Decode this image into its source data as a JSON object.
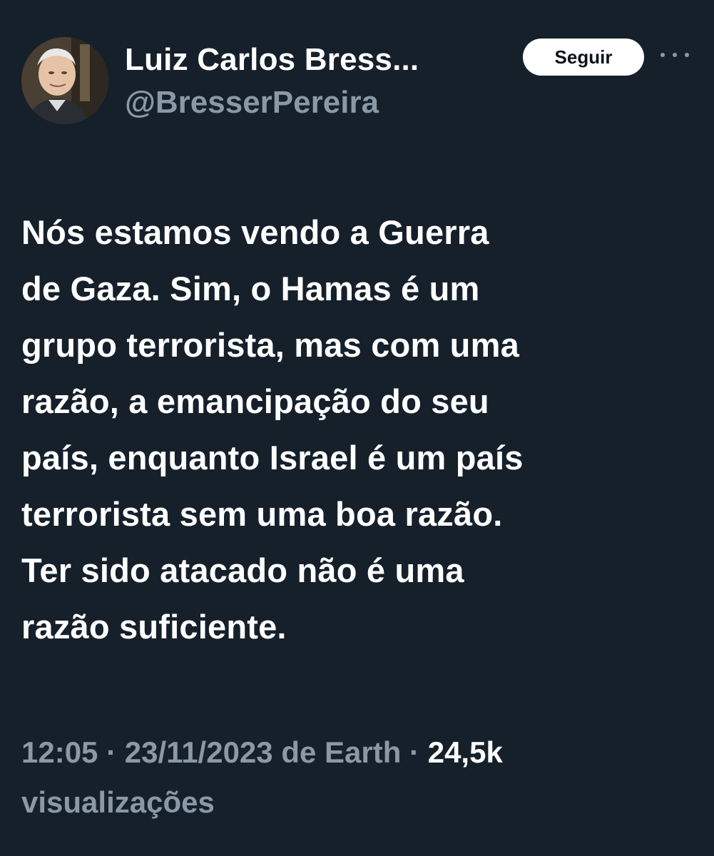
{
  "author": {
    "display_name": "Luiz Carlos Bress...",
    "handle": "@BresserPereira"
  },
  "actions": {
    "follow_label": "Seguir",
    "more_icon": "more-horizontal-icon"
  },
  "tweet": {
    "text": "Nós estamos vendo a Guerra\nde Gaza. Sim, o Hamas é um\ngrupo terrorista, mas com uma\nrazão, a emancipação do seu\npaís, enquanto Israel é um país\nterrorista sem uma boa razão.\nTer sido atacado não é uma\nrazão suficiente.",
    "time": "12:05",
    "date": "23/11/2023",
    "source": "de Earth",
    "separator": "·",
    "views_count": "24,5k",
    "views_label": "visualizações"
  },
  "colors": {
    "background": "#15202b",
    "text_primary": "#ffffff",
    "text_secondary": "#8b98a5",
    "button_bg": "#ffffff"
  }
}
